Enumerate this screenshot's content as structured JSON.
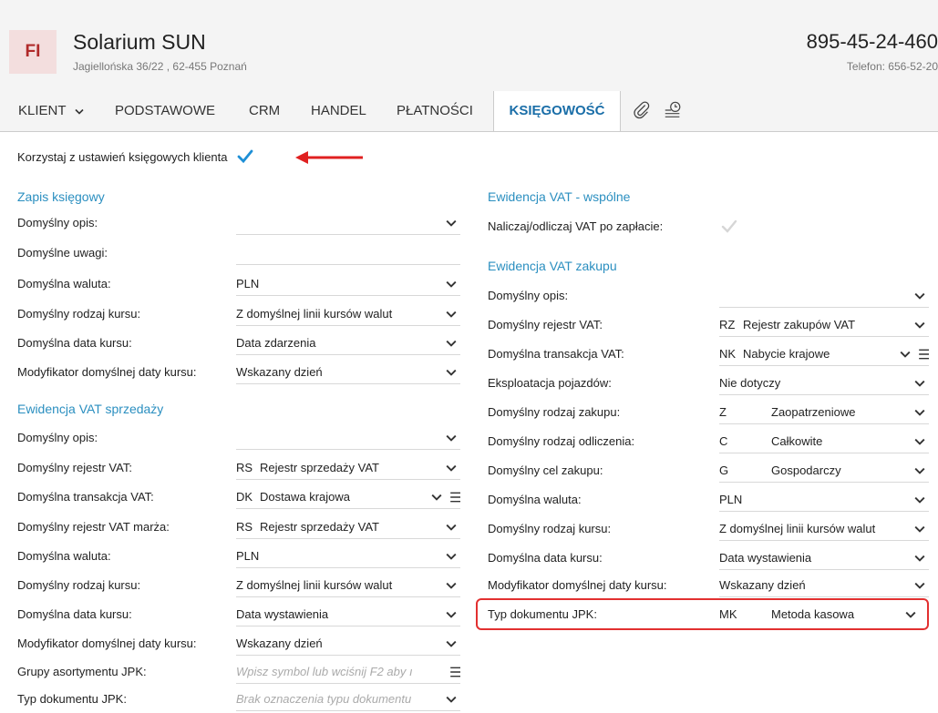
{
  "header": {
    "avatar_text": "FI",
    "client_name": "Solarium SUN",
    "client_address": "Jagiellońska 36/22 , 62-455 Poznań",
    "nip": "895-45-24-460",
    "phone": "Telefon: 656-52-20"
  },
  "tabs": [
    {
      "label": "KLIENT"
    },
    {
      "label": "PODSTAWOWE"
    },
    {
      "label": "CRM"
    },
    {
      "label": "HANDEL"
    },
    {
      "label": "PŁATNOŚCI"
    },
    {
      "label": "KSIĘGOWOŚĆ",
      "active": true
    }
  ],
  "icons": {
    "attach": "paperclip-icon",
    "history": "history-icon"
  },
  "use_client_settings": {
    "label": "Korzystaj z ustawień księgowych klienta",
    "checked": true
  },
  "zapis": {
    "title": "Zapis księgowy",
    "rows": [
      {
        "label": "Domyślny opis:",
        "value": ""
      },
      {
        "label": "Domyślne uwagi:",
        "value": ""
      },
      {
        "label": "Domyślna waluta:",
        "value": "PLN"
      },
      {
        "label": "Domyślny rodzaj kursu:",
        "value": "Z domyślnej linii kursów walut"
      },
      {
        "label": "Domyślna data kursu:",
        "value": "Data zdarzenia"
      },
      {
        "label": "Modyfikator domyślnej daty kursu:",
        "value": "Wskazany dzień"
      }
    ]
  },
  "sprzedaz": {
    "title": "Ewidencja VAT sprzedaży",
    "rows": [
      {
        "label": "Domyślny opis:",
        "value": ""
      },
      {
        "label": "Domyślny rejestr VAT:",
        "code": "RS",
        "name": "Rejestr sprzedaży VAT"
      },
      {
        "label": "Domyślna transakcja VAT:",
        "code": "DK",
        "name": "Dostawa krajowa"
      },
      {
        "label": "Domyślny rejestr VAT marża:",
        "code": "RS",
        "name": "Rejestr sprzedaży VAT"
      },
      {
        "label": "Domyślna waluta:",
        "value": "PLN"
      },
      {
        "label": "Domyślny rodzaj kursu:",
        "value": "Z domyślnej linii kursów walut"
      },
      {
        "label": "Domyślna data kursu:",
        "value": "Data wystawienia"
      },
      {
        "label": "Modyfikator domyślnej daty kursu:",
        "value": "Wskazany dzień"
      },
      {
        "label": "Grupy asortymentu JPK:",
        "placeholder": "Wpisz symbol lub wciśnij F2 aby ı"
      },
      {
        "label": "Typ dokumentu JPK:",
        "placeholder": "Brak oznaczenia typu dokumentu"
      }
    ]
  },
  "wspolne": {
    "title": "Ewidencja VAT - wspólne",
    "rows": [
      {
        "label": "Naliczaj/odliczaj VAT po zapłacie:",
        "checked": false
      }
    ]
  },
  "zakup": {
    "title": "Ewidencja VAT zakupu",
    "rows": [
      {
        "label": "Domyślny opis:",
        "value": ""
      },
      {
        "label": "Domyślny rejestr VAT:",
        "code": "RZ",
        "name": "Rejestr zakupów VAT"
      },
      {
        "label": "Domyślna transakcja VAT:",
        "code": "NK",
        "name": "Nabycie krajowe"
      },
      {
        "label": "Eksploatacja pojazdów:",
        "value": "Nie dotyczy"
      },
      {
        "label": "Domyślny rodzaj zakupu:",
        "code": "Z",
        "name": "Zaopatrzeniowe"
      },
      {
        "label": "Domyślny rodzaj odliczenia:",
        "code": "C",
        "name": "Całkowite"
      },
      {
        "label": "Domyślny cel zakupu:",
        "code": "G",
        "name": "Gospodarczy"
      },
      {
        "label": "Domyślna waluta:",
        "value": "PLN"
      },
      {
        "label": "Domyślny rodzaj kursu:",
        "value": "Z domyślnej linii kursów walut"
      },
      {
        "label": "Domyślna data kursu:",
        "value": "Data wystawienia"
      },
      {
        "label": "Modyfikator domyślnej daty kursu:",
        "value": "Wskazany dzień"
      },
      {
        "label": "Typ dokumentu JPK:",
        "code": "MK",
        "name": "Metoda kasowa"
      }
    ]
  },
  "colors": {
    "accent": "#2b8fc0",
    "active_tab": "#1a6ea8",
    "highlight": "#e23030",
    "avatar_bg": "#f3dede",
    "avatar_fg": "#b02a2a"
  }
}
